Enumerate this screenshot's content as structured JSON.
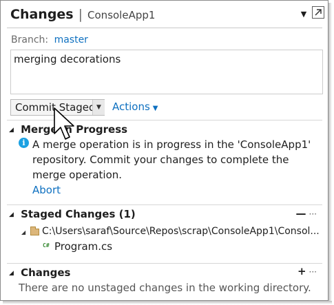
{
  "window": {
    "title": "Changes",
    "subtitle": "ConsoleApp1",
    "menu_icon": "dropdown-caret",
    "navigate_icon": "navigate-out-icon"
  },
  "branch": {
    "label": "Branch:",
    "name": "master"
  },
  "commit": {
    "message": "merging decorations",
    "button_label": "Commit Staged",
    "actions_label": "Actions"
  },
  "merge_section": {
    "title": "Merge In Progress",
    "message": "A merge operation is in progress in the 'ConsoleApp1' repository. Commit your changes to complete the merge operation.",
    "abort_label": "Abort"
  },
  "staged_section": {
    "title": "Staged Changes (1)",
    "folder_path": "C:\\Users\\saraf\\Source\\Repos\\scrap\\ConsoleApp1\\Consol...",
    "files": [
      "Program.cs"
    ],
    "file_icon_text": "C#"
  },
  "changes_section": {
    "title": "Changes",
    "empty_message": "There are no unstaged changes in the working directory."
  },
  "colors": {
    "link": "#0e70c0",
    "info": "#1ba1e2",
    "csharp": "#388a34"
  }
}
